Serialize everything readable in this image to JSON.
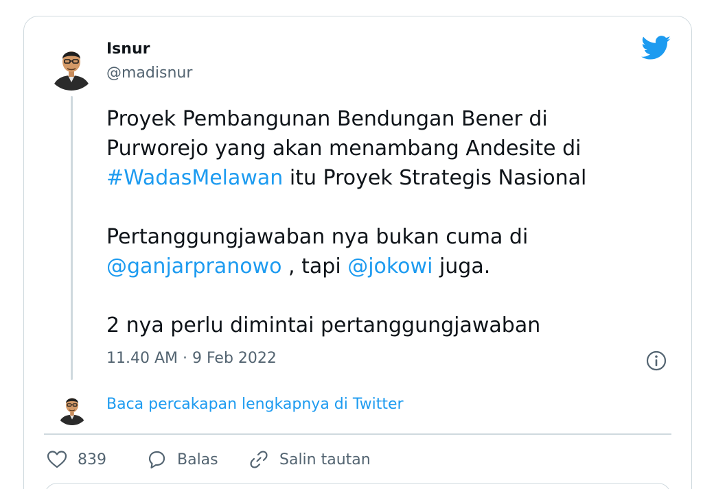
{
  "author": {
    "name": "Isnur",
    "handle": "@madisnur"
  },
  "tweet": {
    "line1": "Proyek Pembangunan Bendungan Bener di",
    "line2": "Purworejo yang akan menambang Andesite di",
    "hashtag": "#WadasMelawan",
    "line3_rest": " itu Proyek Strategis Nasional",
    "line4": "Pertanggungjawaban nya bukan cuma di",
    "mention1": "@ganjarpranowo",
    "mid_text": " , tapi ",
    "mention2": "@jokowi",
    "end_text": " juga.",
    "line6": "2 nya perlu dimintai pertanggungjawaban"
  },
  "timestamp": "11.40 AM · 9 Feb 2022",
  "read_conversation": "Baca percakapan lengkapnya di Twitter",
  "actions": {
    "like_count": "839",
    "reply_label": "Balas",
    "copy_label": "Salin tautan"
  },
  "icons": {
    "brand": "twitter-bird-icon",
    "info": "info-icon",
    "like": "heart-icon",
    "reply": "speech-bubble-icon",
    "copy": "link-icon"
  },
  "colors": {
    "accent": "#1d9bf0",
    "text": "#0f1419",
    "secondary": "#536471",
    "border": "#cfd9de"
  }
}
